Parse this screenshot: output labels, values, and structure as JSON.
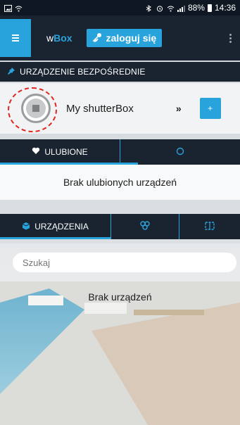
{
  "status_bar": {
    "time": "14:36",
    "battery": "88%"
  },
  "app_bar": {
    "brand_prefix": "w",
    "brand_suffix": "Box",
    "login_label": "zaloguj się"
  },
  "direct_section": {
    "title": "URZĄDZENIE BEZPOŚREDNIE"
  },
  "device": {
    "name": "My shutterBox",
    "more": "»",
    "add": "+"
  },
  "favorites": {
    "tab_label": "ULUBIONE",
    "empty_text": "Brak ulubionych urządzeń"
  },
  "devices": {
    "tab_label": "URZĄDZENIA",
    "search_placeholder": "Szukaj",
    "empty_text": "Brak urządzeń"
  },
  "colors": {
    "accent": "#29a3dc",
    "bar": "#1a2330",
    "highlight_ring": "#e0251b"
  }
}
